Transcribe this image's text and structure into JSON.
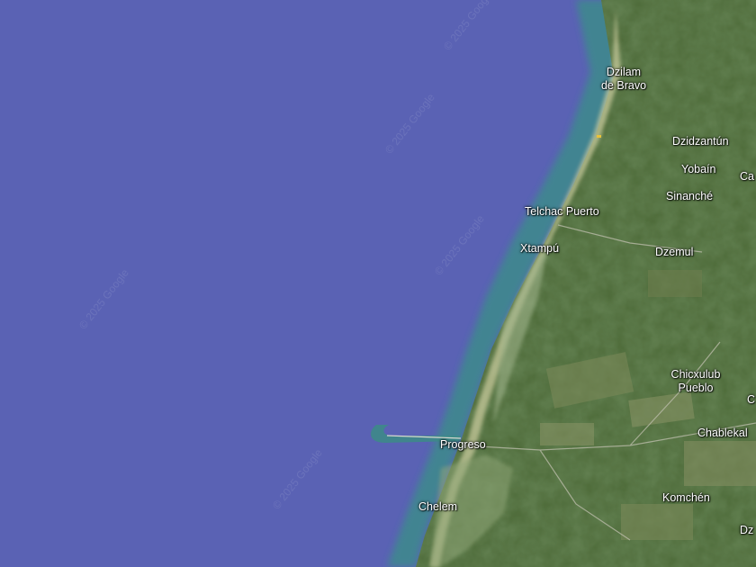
{
  "map": {
    "colors": {
      "ocean": "#5a62b4",
      "shallow_water": "#3f8f8e",
      "land": "#4f6b3a",
      "beach": "#c9c99a"
    },
    "places": [
      {
        "id": "dzilam-de-bravo",
        "lines": [
          "Dzilam",
          "de Bravo"
        ]
      },
      {
        "id": "dzidzantun",
        "lines": [
          "Dzidzantún"
        ]
      },
      {
        "id": "yobain",
        "lines": [
          "Yobaín"
        ]
      },
      {
        "id": "ca",
        "lines": [
          "Ca"
        ]
      },
      {
        "id": "sinanche",
        "lines": [
          "Sinanché"
        ]
      },
      {
        "id": "telchac-puerto",
        "lines": [
          "Telchac Puerto"
        ]
      },
      {
        "id": "xtampu",
        "lines": [
          "Xtampú"
        ]
      },
      {
        "id": "dzemul",
        "lines": [
          "Dzemul"
        ]
      },
      {
        "id": "chicxulub-pueblo",
        "lines": [
          "Chicxulub",
          "Pueblo"
        ]
      },
      {
        "id": "c",
        "lines": [
          "C"
        ]
      },
      {
        "id": "chablekal",
        "lines": [
          "Chablekal"
        ]
      },
      {
        "id": "progreso",
        "lines": [
          "Progreso"
        ]
      },
      {
        "id": "komchen",
        "lines": [
          "Komchén"
        ]
      },
      {
        "id": "chelem",
        "lines": [
          "Chelem"
        ]
      },
      {
        "id": "dz",
        "lines": [
          "Dz"
        ]
      }
    ],
    "watermark": "© 2025 Google"
  }
}
